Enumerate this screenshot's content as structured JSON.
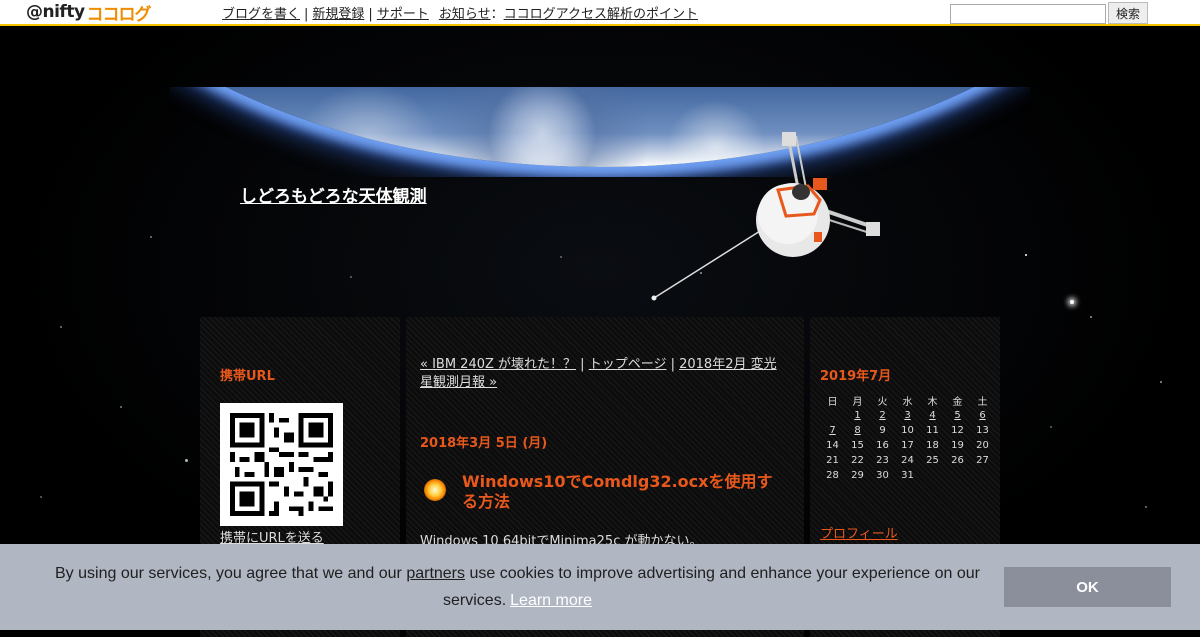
{
  "nifty": {
    "logo_at": "@nifty",
    "logo_coco": "ココログ",
    "nav": [
      "ブログを書く",
      "新規登録",
      "サポート"
    ],
    "notice_label": "お知らせ",
    "notice_colon": "：",
    "notice_link": "ココログアクセス解析のポイント",
    "search_button": "検索",
    "search_value": ""
  },
  "blog": {
    "title": "しどろもどろな天体観測"
  },
  "left": {
    "mobile_title": "携帯URL",
    "send_url_link": "携帯にURLを送る"
  },
  "post": {
    "prev_link": "« IBM 240Z が壊れた！？",
    "sep1": " | ",
    "top_link": "トップページ",
    "sep2": " | ",
    "next_link": "2018年2月 変光星観測月報 »",
    "date": "2018年3月 5日 (月)",
    "title": "Windows10でComdlg32.ocxを使用する方法",
    "body": "Windows 10 64bitでMinima25c が動かない。"
  },
  "calendar": {
    "title": "2019年7月",
    "weekdays": [
      "日",
      "月",
      "火",
      "水",
      "木",
      "金",
      "土"
    ],
    "rows": [
      [
        "",
        "1",
        "2",
        "3",
        "4",
        "5",
        "6"
      ],
      [
        "7",
        "8",
        "9",
        "10",
        "11",
        "12",
        "13"
      ],
      [
        "14",
        "15",
        "16",
        "17",
        "18",
        "19",
        "20"
      ],
      [
        "21",
        "22",
        "23",
        "24",
        "25",
        "26",
        "27"
      ],
      [
        "28",
        "29",
        "30",
        "31",
        "",
        "",
        ""
      ]
    ],
    "linked_days": [
      "1",
      "2",
      "3",
      "4",
      "5",
      "6",
      "7",
      "8"
    ],
    "profile_link": "プロフィール"
  },
  "cookie": {
    "text_before": "By using our services, you agree that we and our ",
    "partners_link": "partners",
    "text_after": " use cookies to improve advertising and enhance your experience on our services.",
    "learn_more": "Learn more",
    "ok_button": "OK"
  },
  "colors": {
    "accent_orange": "#e8581c",
    "topbar_border": "#f4c400",
    "cookie_bg": "#b0b6c2",
    "ok_button_bg": "#8a8f9b"
  }
}
